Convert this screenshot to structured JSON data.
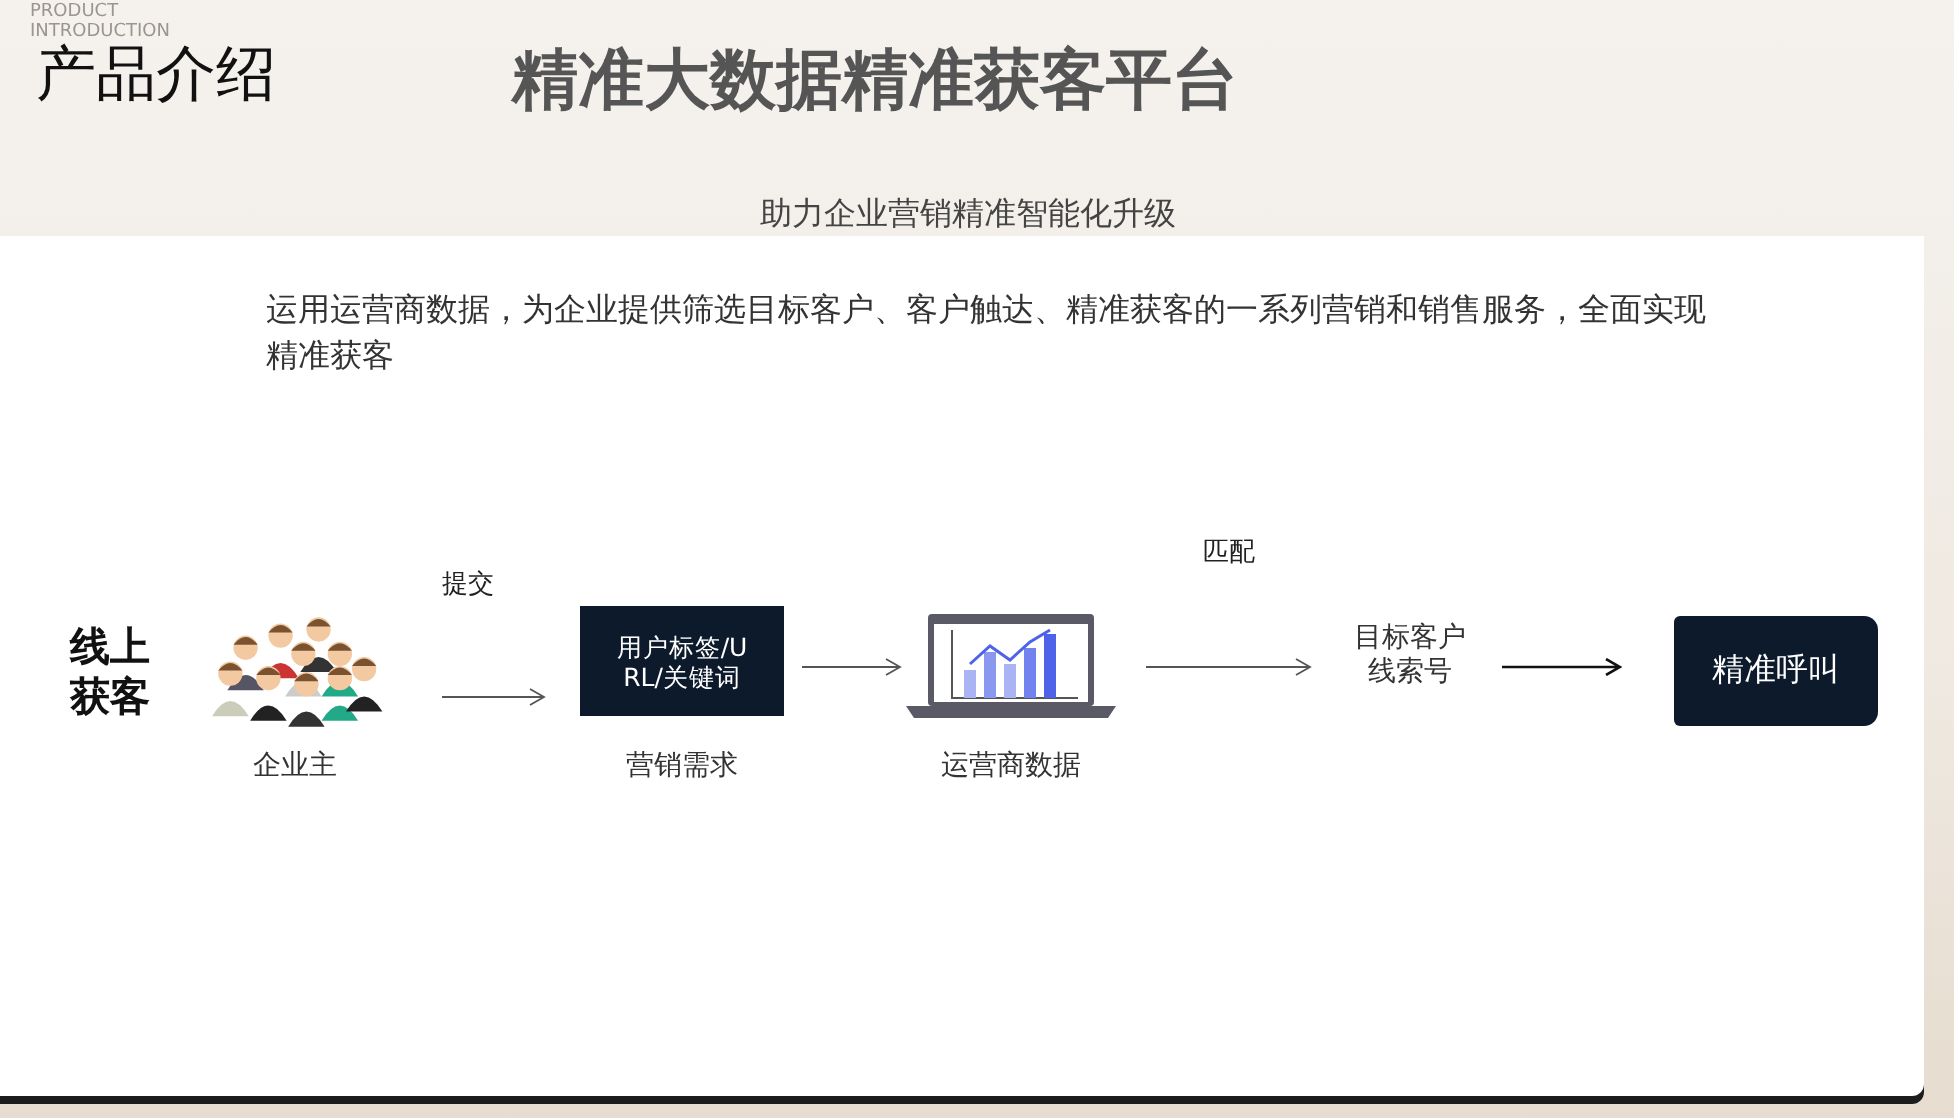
{
  "header": {
    "watermark": "PRODUCT INTRODUCTION",
    "section": "产品介绍",
    "title": "精准大数据精准获客平台",
    "subtitle": "助力企业营销精准智能化升级"
  },
  "description": "运用运营商数据，为企业提供筛选目标客户、客户触达、精准获客的一系列营销和销售服务，全面实现精准获客",
  "flow": {
    "label": "线上获客",
    "nodes": [
      {
        "kind": "people",
        "caption": "企业主"
      },
      {
        "kind": "arrow",
        "label": "提交"
      },
      {
        "kind": "box",
        "text": "用户标签/URL/关键词",
        "caption": "营销需求"
      },
      {
        "kind": "arrow"
      },
      {
        "kind": "laptop",
        "caption": "运营商数据"
      },
      {
        "kind": "arrow",
        "label": "匹配"
      },
      {
        "kind": "text",
        "text": "目标客户线索号"
      },
      {
        "kind": "arrow"
      },
      {
        "kind": "button",
        "text": "精准呼叫"
      }
    ]
  }
}
